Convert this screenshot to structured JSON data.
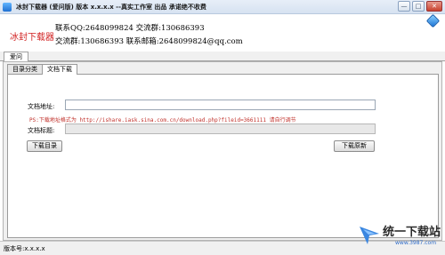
{
  "window": {
    "title": "冰封下载器 (爱问版)  版本 x.x.x.x  --真实工作室 出品  承诺绝不收费",
    "controls": {
      "minimize": "—",
      "maximize": "□",
      "close": "✕"
    }
  },
  "header": {
    "brand": "冰封下载器",
    "contact_line1": "联系QQ:2648099824 交流群:130686393",
    "contact_line2": "交流群:130686393    联系邮箱:2648099824@qq.com"
  },
  "outer_tabs": [
    {
      "label": "爱问"
    }
  ],
  "inner_tabs": [
    {
      "label": "目录分类"
    },
    {
      "label": "文档下载"
    }
  ],
  "form": {
    "url_label": "文档地址:",
    "url_value": "",
    "hint": "PS:下载地址格式为 http://ishare.iask.sina.com.cn/download.php?fileid=3661111  请自行调节",
    "title_label": "文档标题:",
    "title_value": ""
  },
  "buttons": {
    "download_dir": "下载目录",
    "download_doc": "下载原新"
  },
  "statusbar": {
    "text": "版本号:x.x.x.x"
  },
  "watermark": {
    "text": "统一下载站",
    "url": "www.3987.com"
  },
  "colors": {
    "brand": "#d11f1f",
    "hint": "#c0302a",
    "titlebar": "#d6e2f1"
  }
}
